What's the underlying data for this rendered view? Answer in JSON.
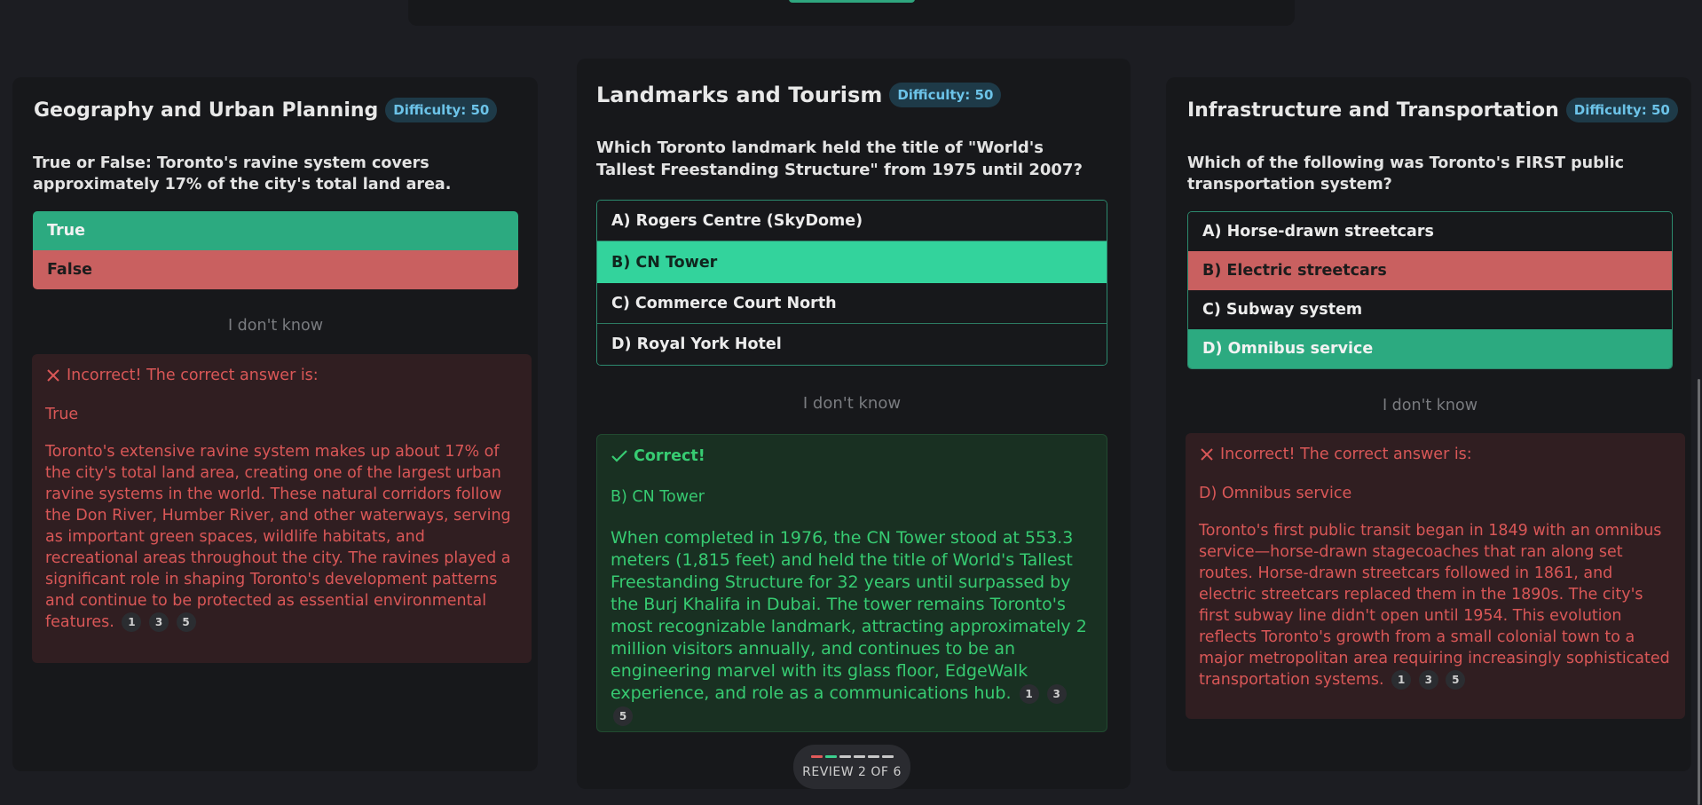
{
  "review": {
    "label": "REVIEW 2 OF 6",
    "segments": [
      "#e05a5a",
      "#3ccf8e",
      "#c8c8c8",
      "#c8c8c8",
      "#c8c8c8",
      "#c8c8c8"
    ]
  },
  "left": {
    "title": "Geography and Urban Planning",
    "difficulty": "Difficulty: 50",
    "question": "True or False: Toronto's ravine system covers approximately 17% of the city's total land area.",
    "options": [
      "True",
      "False"
    ],
    "idk": "I don't know",
    "feedback_head": "Incorrect! The correct answer is:",
    "feedback_answer": "True",
    "feedback_expl": "Toronto's extensive ravine system makes up about 17% of the city's total land area, creating one of the largest urban ravine systems in the world. These natural corridors follow the Don River, Humber River, and other waterways, serving as important green spaces, wildlife habitats, and recreational areas throughout the city. The ravines played a significant role in shaping Toronto's development patterns and continue to be protected as essential environmental features.",
    "citations": [
      "1",
      "3",
      "5"
    ]
  },
  "center": {
    "title": "Landmarks and Tourism",
    "difficulty": "Difficulty: 50",
    "question": "Which Toronto landmark held the title of \"World's Tallest Freestanding Structure\" from 1975 until 2007?",
    "options": [
      "A) Rogers Centre (SkyDome)",
      "B) CN Tower",
      "C) Commerce Court North",
      "D) Royal York Hotel"
    ],
    "idk": "I don't know",
    "feedback_head": "Correct!",
    "feedback_answer": "B) CN Tower",
    "feedback_expl": "When completed in 1976, the CN Tower stood at 553.3 meters (1,815 feet) and held the title of World's Tallest Freestanding Structure for 32 years until surpassed by the Burj Khalifa in Dubai. The tower remains Toronto's most recognizable landmark, attracting approximately 2 million visitors annually, and continues to be an engineering marvel with its glass floor, EdgeWalk experience, and role as a communications hub.",
    "citations": [
      "1",
      "3",
      "5"
    ]
  },
  "right": {
    "title": "Infrastructure and Transportation",
    "difficulty": "Difficulty: 50",
    "question": "Which of the following was Toronto's FIRST public transportation system?",
    "options": [
      "A) Horse-drawn streetcars",
      "B) Electric streetcars",
      "C) Subway system",
      "D) Omnibus service"
    ],
    "idk": "I don't know",
    "feedback_head": "Incorrect! The correct answer is:",
    "feedback_answer": "D) Omnibus service",
    "feedback_expl": "Toronto's first public transit began in 1849 with an omnibus service—horse-drawn stagecoaches that ran along set routes. Horse-drawn streetcars followed in 1861, and electric streetcars replaced them in the 1890s. The city's first subway line didn't open until 1954. This evolution reflects Toronto's growth from a small colonial town to a major metropolitan area requiring increasingly sophisticated transportation systems.",
    "citations": [
      "1",
      "3",
      "5"
    ]
  }
}
